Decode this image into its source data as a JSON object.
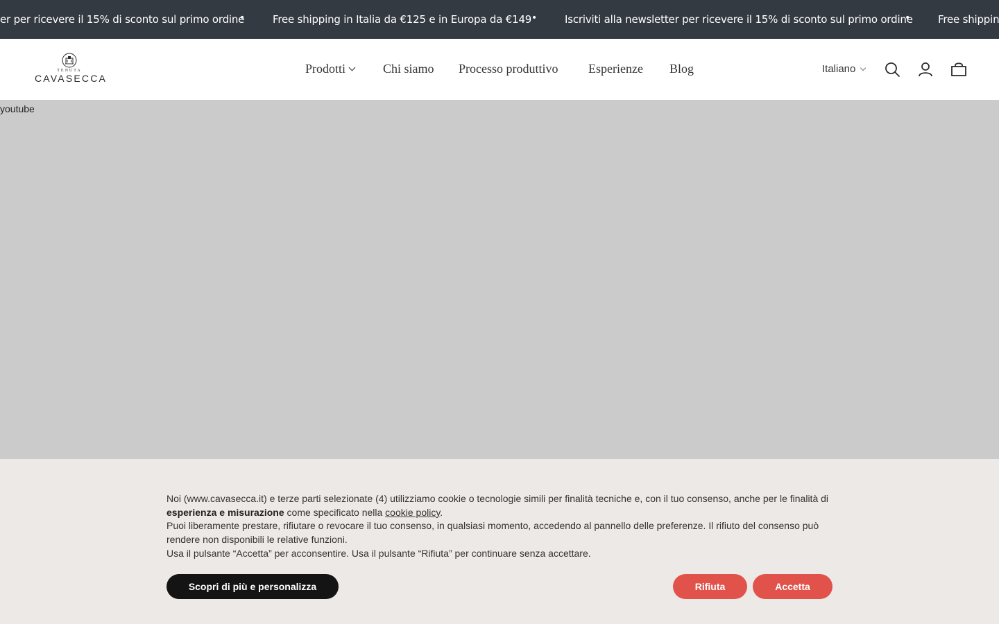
{
  "announcement": {
    "messages": [
      "er per ricevere il 15% di sconto sul primo ordine",
      "Free shipping in Italia da €125 e in Europa da €149",
      "Iscriviti alla newsletter per ricevere il 15% di sconto sul primo ordine",
      "Free shipping"
    ],
    "separator": "•",
    "background": "#343a42"
  },
  "header": {
    "logo": {
      "top_text": "TENUTA",
      "name": "CAVASECCA"
    },
    "nav": [
      {
        "label": "Prodotti",
        "has_dropdown": true
      },
      {
        "label": "Chi siamo"
      },
      {
        "label": "Processo produttivo"
      },
      {
        "label": "Esperienze"
      },
      {
        "label": "Blog"
      }
    ],
    "language": "Italiano",
    "icons": [
      "search-icon",
      "account-icon",
      "cart-icon"
    ]
  },
  "video": {
    "placeholder_label": "youtube",
    "background": "#cbcbcb"
  },
  "cookie_banner": {
    "p1_before_bold": "Noi (www.cavasecca.it) e terze parti selezionate (4) utilizziamo cookie o tecnologie simili per finalità tecniche e, con il tuo consenso, anche per le finalità di ",
    "p1_bold": "esperienza e misurazione",
    "p1_after_bold": " come specificato nella ",
    "p1_link": "cookie policy",
    "p1_end": ".",
    "p2": "Puoi liberamente prestare, rifiutare o revocare il tuo consenso, in qualsiasi momento, accedendo al pannello delle preferenze. Il rifiuto del consenso può rendere non disponibili le relative funzioni.",
    "p3": "Usa il pulsante “Accetta” per acconsentire. Usa il pulsante “Rifiuta” per continuare senza accettare.",
    "buttons": {
      "customize": "Scopri di più e personalizza",
      "reject": "Rifiuta",
      "accept": "Accetta"
    },
    "background": "#ede9e6",
    "accent": "#e0524a"
  }
}
